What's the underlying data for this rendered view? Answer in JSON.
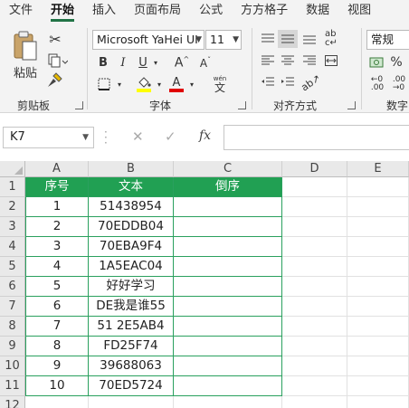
{
  "ribbon_tabs": [
    "文件",
    "开始",
    "插入",
    "页面布局",
    "公式",
    "方方格子",
    "数据",
    "视图"
  ],
  "active_tab": "开始",
  "clipboard": {
    "paste_label": "粘贴",
    "group_label": "剪贴板"
  },
  "font": {
    "name": "Microsoft YaHei UI",
    "size": "11",
    "group_label": "字体",
    "bold": "B",
    "italic": "I",
    "underline": "U",
    "wen": "wén",
    "wen_char": "文"
  },
  "alignment": {
    "group_label": "对齐方式"
  },
  "number": {
    "format": "常规",
    "group_label": "数字"
  },
  "colors": {
    "accent": "#217346",
    "table_header": "#21a053",
    "table_border": "#2aa05e",
    "font_color_bar": "#e00000",
    "fill_color_bar": "#ffff00"
  },
  "formula_bar": {
    "name_box": "K7",
    "fx": "fx",
    "content": ""
  },
  "sheet": {
    "columns": [
      "A",
      "B",
      "C",
      "D",
      "E"
    ],
    "rows": [
      "1",
      "2",
      "3",
      "4",
      "5",
      "6",
      "7",
      "8",
      "9",
      "10",
      "11",
      "12"
    ],
    "header": [
      "序号",
      "文本",
      "倒序"
    ],
    "data": [
      [
        "1",
        "51438954",
        ""
      ],
      [
        "2",
        "70EDDB04",
        ""
      ],
      [
        "3",
        "70EBA9F4",
        ""
      ],
      [
        "4",
        "1A5EAC04",
        ""
      ],
      [
        "5",
        "好好学习",
        ""
      ],
      [
        "6",
        "DE我是谁55",
        ""
      ],
      [
        "7",
        "51 2E5AB4",
        ""
      ],
      [
        "8",
        "FD25F74",
        ""
      ],
      [
        "9",
        "39688063",
        ""
      ],
      [
        "10",
        "70ED5724",
        ""
      ]
    ]
  }
}
